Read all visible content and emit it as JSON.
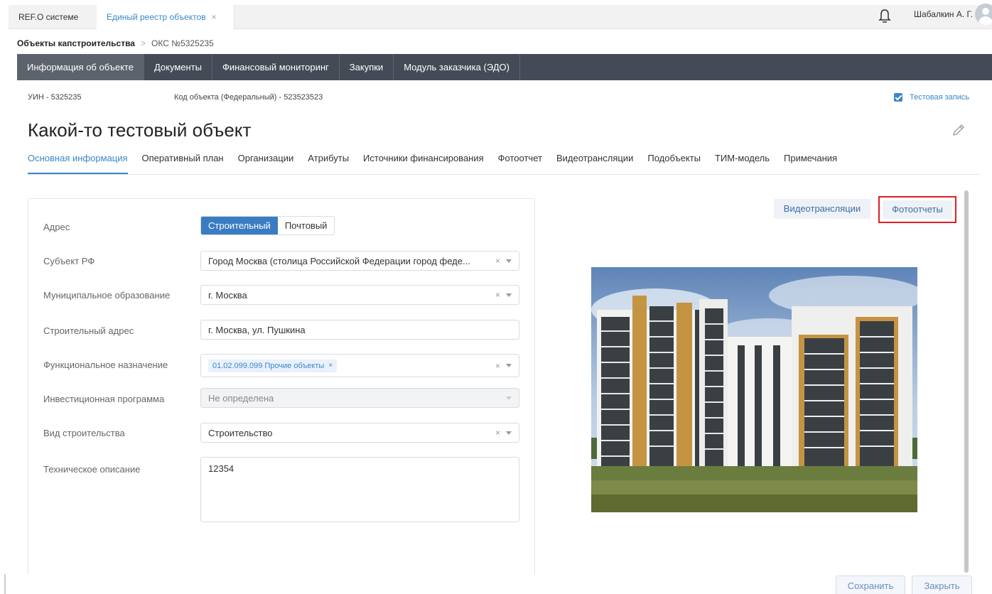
{
  "app_tabs": [
    {
      "label": "REF.O системе"
    },
    {
      "label": "Единый реестр объектов",
      "close": "×"
    }
  ],
  "user": {
    "name": "Шабалкин А. Г."
  },
  "breadcrumb": {
    "root": "Объекты капстроительства",
    "sep": ">",
    "current": "ОКС №5325235"
  },
  "main_nav": [
    {
      "label": "Информация об объекте"
    },
    {
      "label": "Документы"
    },
    {
      "label": "Финансовый мониторинг"
    },
    {
      "label": "Закупки"
    },
    {
      "label": "Модуль заказчика (ЭДО)"
    }
  ],
  "info": {
    "uin": "УИН - 5325235",
    "fed_code": "Код объекта (Федеральный) - 523523523",
    "test_record": "Тестовая запись"
  },
  "title": "Какой-то тестовый объект",
  "sub_tabs": [
    {
      "label": "Основная информация"
    },
    {
      "label": "Оперативный план"
    },
    {
      "label": "Организации"
    },
    {
      "label": "Атрибуты"
    },
    {
      "label": "Источники финансирования"
    },
    {
      "label": "Фотоотчет"
    },
    {
      "label": "Видеотрансляции"
    },
    {
      "label": "Подобъекты"
    },
    {
      "label": "ТИМ-модель"
    },
    {
      "label": "Примечания"
    }
  ],
  "form": {
    "address": {
      "label": "Адрес",
      "opt1": "Строительный",
      "opt2": "Почтовый"
    },
    "subject": {
      "label": "Субъект РФ",
      "value": "Город Москва (столица Российской Федерации город феде..."
    },
    "municipal": {
      "label": "Муниципальное образование",
      "value": "г. Москва"
    },
    "build_address": {
      "label": "Строительный адрес",
      "value": "г. Москва, ул. Пушкина"
    },
    "functional": {
      "label": "Функциональное назначение",
      "chip": "01.02.099.099 Прочие объекты",
      "chip_x": "×"
    },
    "invest": {
      "label": "Инвестиционная программа",
      "value": "Не определена"
    },
    "build_type": {
      "label": "Вид строительства",
      "value": "Строительство"
    },
    "tech_desc": {
      "label": "Техническое описание",
      "value": "12354"
    },
    "clear_symbol": "×"
  },
  "media": {
    "video_btn": "Видеотрансляции",
    "photo_btn": "Фотоотчеты"
  },
  "actions": {
    "save": "Сохранить",
    "close": "Закрыть"
  }
}
